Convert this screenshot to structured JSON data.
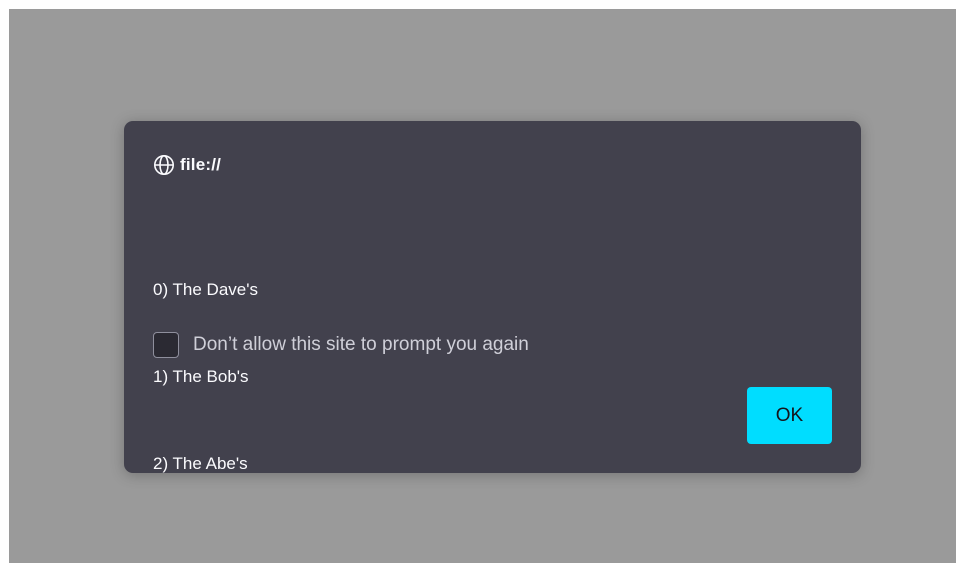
{
  "dialog": {
    "origin_icon": "globe-icon",
    "origin": "file://",
    "message_lines": [
      "0) The Dave's",
      "1) The Bob's",
      "2) The Abe's"
    ],
    "checkbox_label": "Don’t allow this site to prompt you again",
    "checkbox_checked": false,
    "ok_label": "OK"
  },
  "colors": {
    "overlay": "#9a9a9a",
    "dialog_bg": "#42414d",
    "accent": "#00ddff",
    "text": "#fbfbfe"
  }
}
